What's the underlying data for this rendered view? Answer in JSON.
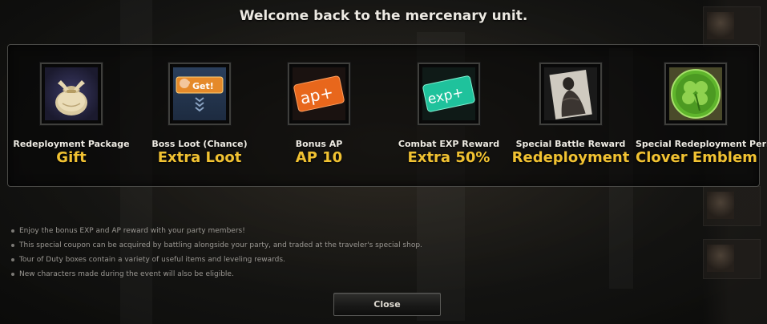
{
  "dialog": {
    "title": "Welcome back to the mercenary unit.",
    "close_label": "Close"
  },
  "rewards": [
    {
      "label": "Redeployment Package",
      "value": "Gift",
      "icon": "gift-bag-icon"
    },
    {
      "label": "Boss Loot (Chance)",
      "value": "Extra Loot",
      "icon": "loot-get-icon",
      "icon_text": "Get!"
    },
    {
      "label": "Bonus AP",
      "value": "AP 10",
      "icon": "ap-plus-icon",
      "icon_text": "ap+"
    },
    {
      "label": "Combat EXP Reward",
      "value": "Extra 50%",
      "icon": "exp-plus-icon",
      "icon_text": "exp+"
    },
    {
      "label": "Special Battle Reward",
      "value": "Redeployment",
      "icon": "character-card-icon"
    },
    {
      "label": "Special Redeployment Perk",
      "value": "Clover Emblem",
      "icon": "clover-emblem-icon"
    }
  ],
  "notes": [
    "Enjoy the bonus EXP and AP reward with your party members!",
    "This special coupon can be acquired by battling alongside your party, and traded at the traveler's special shop.",
    "Tour of Duty boxes contain a variety of useful items and leveling rewards.",
    "New characters made during the event will also be eligible."
  ],
  "colors": {
    "value_gold": "#f1c232",
    "label_white": "#efece4",
    "note_gray": "#9a9792",
    "ap_orange": "#e8671c",
    "exp_teal": "#1fc29c",
    "clover_green": "#5fb52c"
  }
}
